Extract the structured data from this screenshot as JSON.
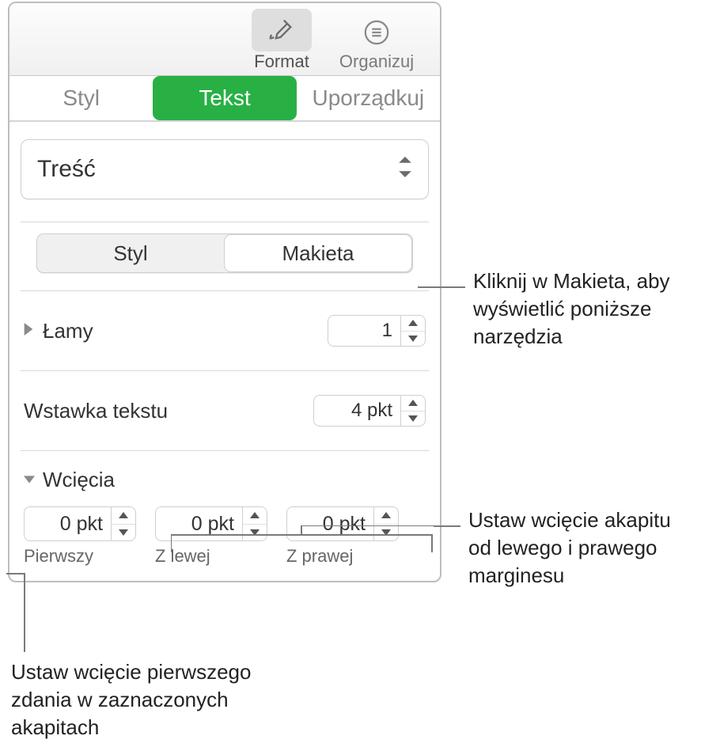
{
  "toolbar": {
    "format": {
      "label": "Format"
    },
    "organize": {
      "label": "Organizuj"
    }
  },
  "tabs": {
    "style": "Styl",
    "text": "Tekst",
    "arrange": "Uporządkuj"
  },
  "dropdown": {
    "value": "Treść"
  },
  "segment": {
    "style": "Styl",
    "layout": "Makieta"
  },
  "columns": {
    "label": "Łamy",
    "value": "1"
  },
  "textInset": {
    "label": "Wstawka tekstu",
    "value": "4 pkt"
  },
  "indents": {
    "label": "Wcięcia",
    "first": {
      "label": "Pierwszy",
      "value": "0 pkt"
    },
    "left": {
      "label": "Z lewej",
      "value": "0 pkt"
    },
    "right": {
      "label": "Z prawej",
      "value": "0 pkt"
    }
  },
  "callouts": {
    "layout": "Kliknij w Makieta, aby wyświetlić poniższe narzędzia",
    "margins": "Ustaw wcięcie akapitu od lewego i prawego marginesu",
    "firstLine": "Ustaw wcięcie pierwszego zdania w zaznaczonych akapitach"
  }
}
